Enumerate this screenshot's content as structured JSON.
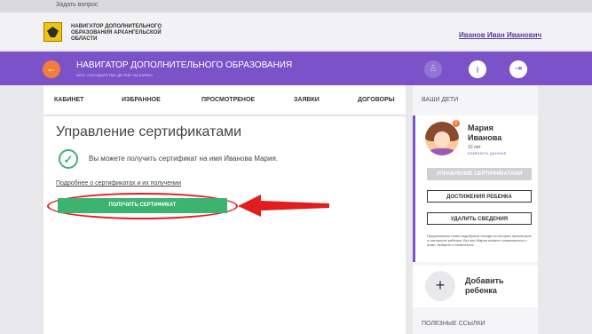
{
  "topbar": {
    "ask_link": "Задать вопрос"
  },
  "header": {
    "org_name": "НАВИГАТОР ДОПОЛНИТЕЛЬНОГО ОБРАЗОВАНИЯ АРХАНГЕЛЬСКОЙ ОБЛАСТИ",
    "user_name": "Иванов Иван Иванович"
  },
  "navbar": {
    "back_icon": "←",
    "title": "НАВИГАТОР ДОПОЛНИТЕЛЬНОГО ОБРАЗОВАНИЯ",
    "subtitle": "ООО «ГОСУДАРСТВО ДЕТЕЙ» iKLEARNO",
    "user_icon": "♙",
    "filter_icon": "⫲",
    "exit_icon": "⇥",
    "accent": "#7b52c8",
    "back_color": "#f47d3b"
  },
  "tabs": [
    "КАБИНЕТ",
    "ИЗБРАННОЕ",
    "ПРОСМОТРЕНОЕ",
    "ЗАЯВКИ",
    "ДОГОВОРЫ"
  ],
  "main": {
    "heading": "Управление сертификатами",
    "check_icon": "✓",
    "message": "Вы можете получить сертификат на имя Иванова Мария.",
    "info_link": "Подробнее о сертификатах и их получении",
    "get_button": "ПОЛУЧИТЬ СЕРТИФИКАТ",
    "button_color": "#3cb371",
    "highlight_color": "#e11d1d"
  },
  "sidebar": {
    "title": "ВАШИ ДЕТИ",
    "child": {
      "first_name": "Мария",
      "last_name": "Иванова",
      "age": "10 лет",
      "edit_link": "ИЗМЕНИТЬ ДАННЫЕ",
      "badge": "!"
    },
    "buttons": {
      "manage": "УПРАВЛЕНИЕ СЕРТИФИКАТАМИ",
      "achievements": "ДОСТИЖЕНИЯ РЕБЕНКА",
      "delete": "УДАЛИТЬ СВЕДЕНИЯ"
    },
    "note": "Предложения слева подобраны исходя из истории просмотров и интересов ребенка. Вы или Мария можете ознакомиться с ними, выбрать и записаться.",
    "add": {
      "icon": "+",
      "label": "Добавить ребенка"
    },
    "useful_links": "ПОЛЕЗНЫЕ ССЫЛКИ"
  }
}
